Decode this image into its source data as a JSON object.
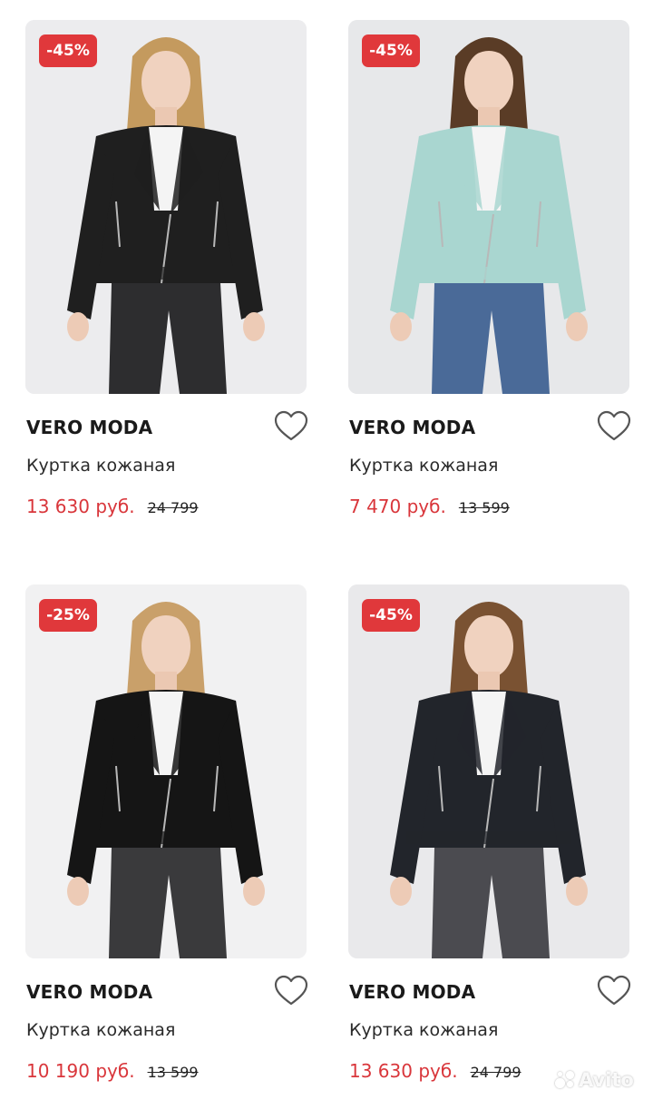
{
  "products": [
    {
      "discount": "-45%",
      "brand": "VERO MODA",
      "title": "Куртка кожаная",
      "price": "13 630 руб.",
      "old_price": "24 799",
      "jacket_color": "#1f1f1f",
      "hair_color": "#c49a5e",
      "pants_color": "#2d2d2f",
      "photo_bg": "#ececee"
    },
    {
      "discount": "-45%",
      "brand": "VERO MODA",
      "title": "Куртка кожаная",
      "price": "7 470 руб.",
      "old_price": "13 599",
      "jacket_color": "#a9d6d0",
      "hair_color": "#5a3c26",
      "pants_color": "#4a6a98",
      "photo_bg": "#e7e8ea"
    },
    {
      "discount": "-25%",
      "brand": "VERO MODA",
      "title": "Куртка кожаная",
      "price": "10 190 руб.",
      "old_price": "13 599",
      "jacket_color": "#151515",
      "hair_color": "#c9a06a",
      "pants_color": "#3a3a3c",
      "photo_bg": "#f1f1f2"
    },
    {
      "discount": "-45%",
      "brand": "VERO MODA",
      "title": "Куртка кожаная",
      "price": "13 630 руб.",
      "old_price": "24 799",
      "jacket_color": "#22252b",
      "hair_color": "#7a5232",
      "pants_color": "#4b4b50",
      "photo_bg": "#e9e9eb"
    }
  ],
  "colors": {
    "accent_red": "#e0383b",
    "price_red": "#d9363b",
    "text_dark": "#1a1a1a"
  },
  "icons": {
    "favorite": "heart-outline-icon"
  },
  "watermark": "Avito"
}
